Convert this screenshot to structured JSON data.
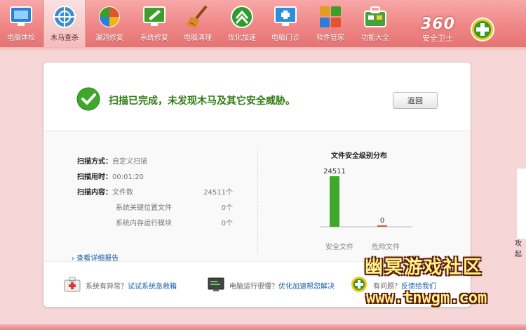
{
  "toolbar": {
    "items": [
      {
        "label": "电脑体检",
        "icon": "monitor-icon",
        "color": "#2c7fd6"
      },
      {
        "label": "木马查杀",
        "icon": "target-icon",
        "color": "#3a8fd0"
      },
      {
        "label": "漏洞修复",
        "icon": "windows-shield-icon",
        "color": "#e0562a"
      },
      {
        "label": "系统修复",
        "icon": "repair-monitor-icon",
        "color": "#3aa02a"
      },
      {
        "label": "电脑清理",
        "icon": "broom-icon",
        "color": "#b86a20"
      },
      {
        "label": "优化加速",
        "icon": "speedup-icon",
        "color": "#2f9b2a"
      },
      {
        "label": "电脑门诊",
        "icon": "clinic-monitor-icon",
        "color": "#2d90d6"
      },
      {
        "label": "软件管家",
        "icon": "software-grid-icon",
        "color": "#e59a22"
      },
      {
        "label": "功能大全",
        "icon": "toolbox-icon",
        "color": "#4aa03a"
      }
    ],
    "active_index": 1
  },
  "brand": {
    "name": "360",
    "subtitle": "安全卫士"
  },
  "result": {
    "title": "扫描已完成，未发现木马及其它安全威胁。",
    "back_label": "返回"
  },
  "scan": {
    "method_label": "扫描方式：",
    "method_value": "自定义扫描",
    "time_label": "扫描用时：",
    "time_value": "00:01:20",
    "content_label": "扫描内容：",
    "content_rows": [
      {
        "name": "文件数",
        "value": "24511个"
      },
      {
        "name": "系统关键位置文件",
        "value": "0个"
      },
      {
        "name": "系统内存运行模块",
        "value": "0个"
      }
    ],
    "detail_link": "查看详细报告"
  },
  "chart_data": {
    "type": "bar",
    "title": "文件安全级别分布",
    "categories": [
      "安全文件",
      "危险文件"
    ],
    "values": [
      24511,
      0
    ],
    "data_labels": [
      "24511",
      "0"
    ],
    "colors": [
      "#3fa82a",
      "#e0563a"
    ]
  },
  "footer": {
    "items": [
      {
        "icon": "first-aid-kit-icon",
        "text": "系统有异常？",
        "link": "试试系统急救箱"
      },
      {
        "icon": "terminal-monitor-icon",
        "text": "电脑运行很慢？",
        "link": "优化加速帮您解决"
      },
      {
        "icon": "feedback-plus-icon",
        "text": "有问题？",
        "link": "反馈给我们"
      }
    ]
  },
  "watermark": {
    "line1": "幽冥游戏社区",
    "line2": "www.tnwgm.com"
  },
  "edge_text": "攻起"
}
